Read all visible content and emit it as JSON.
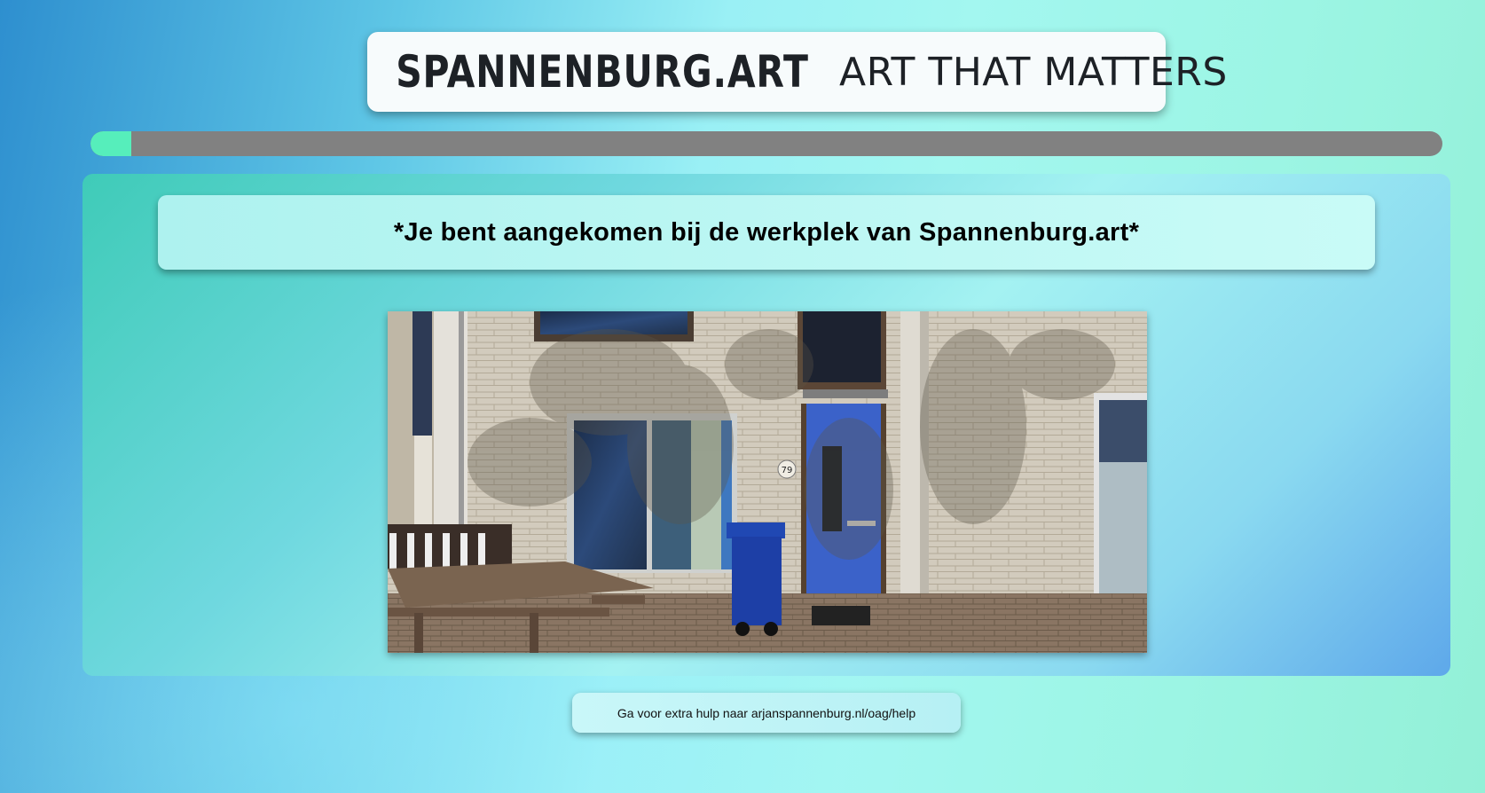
{
  "header": {
    "brand": "SPANNENBURG.ART",
    "tagline": "ART THAT MATTERS"
  },
  "progress": {
    "fraction": 0.03,
    "color": "#56eebb",
    "track_color": "#818181"
  },
  "main": {
    "title": "*Je bent aangekomen bij de werkplek van Spannenburg.art*",
    "photo": {
      "house_number": "79"
    }
  },
  "footer": {
    "help_text": "Ga voor extra hulp naar arjanspannenburg.nl/oag/help"
  }
}
